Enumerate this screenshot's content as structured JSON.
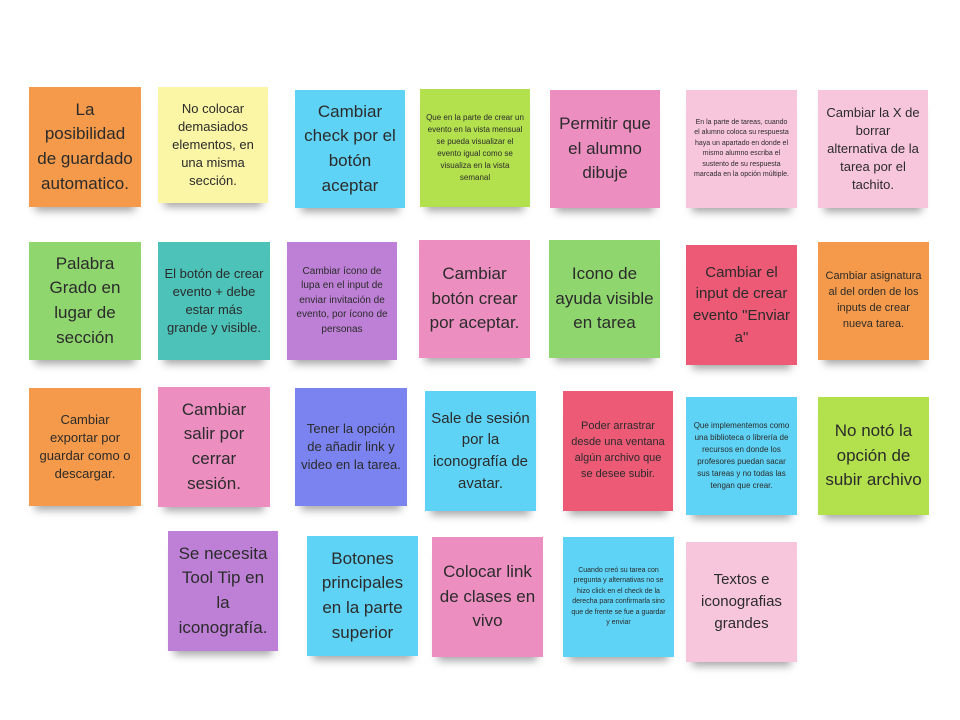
{
  "notes": [
    {
      "text": "La posibilidad de guardado automatico.",
      "color": "#f59a4a"
    },
    {
      "text": "No colocar demasiados elementos, en una misma sección.",
      "color": "#fbf5a6"
    },
    {
      "text": "Cambiar check por el botón aceptar",
      "color": "#5fd3f5"
    },
    {
      "text": "Que en la parte de crear un evento en la vista mensual se pueda visualizar el evento igual como se visualiza en la vista semanal",
      "color": "#b3e04d"
    },
    {
      "text": "Permitir que el alumno dibuje",
      "color": "#ec8fc0"
    },
    {
      "text": "En la parte de tareas, cuando el alumno coloca su respuesta haya un apartado en donde el mismo alumno escriba el sustento de su respuesta marcada en la opción múltiple.",
      "color": "#f8c6dc"
    },
    {
      "text": "Cambiar la X de borrar alternativa de la tarea por el tachito.",
      "color": "#f8c6dc"
    },
    {
      "text": "Palabra Grado en lugar de sección",
      "color": "#8fd66e"
    },
    {
      "text": "El botón de crear evento + debe estar más grande y visible.",
      "color": "#4dc2b9"
    },
    {
      "text": "Cambiar ícono de lupa en el input de enviar invitación de evento, por ícono de personas",
      "color": "#be80d6"
    },
    {
      "text": "Cambiar botón crear por aceptar.",
      "color": "#ec8fc0"
    },
    {
      "text": "Icono de ayuda visible en tarea",
      "color": "#8fd66e"
    },
    {
      "text": "Cambiar el input de crear evento \"Enviar a\"",
      "color": "#ec5a76"
    },
    {
      "text": "Cambiar asignatura al del orden de los inputs de crear nueva tarea.",
      "color": "#f59a4a"
    },
    {
      "text": "Cambiar exportar por guardar como o descargar.",
      "color": "#f59a4a"
    },
    {
      "text": "Cambiar salir por cerrar sesión.",
      "color": "#ec8fc0"
    },
    {
      "text": "Tener la opción de añadir link y video en la tarea.",
      "color": "#7b83f0"
    },
    {
      "text": "Sale de sesión por la iconografía de avatar.",
      "color": "#5fd3f5"
    },
    {
      "text": "Poder arrastrar desde una ventana algún archivo que se desee subir.",
      "color": "#ec5a76"
    },
    {
      "text": "Que implementemos como una biblioteca o librería de recursos en donde los profesores puedan sacar sus tareas y no todas las tengan que crear.",
      "color": "#5fd3f5"
    },
    {
      "text": "No notó la opción de subir archivo",
      "color": "#b3e04d"
    },
    {
      "text": "Se necesita Tool Tip en la iconografía.",
      "color": "#be80d6"
    },
    {
      "text": "Botones principales en la parte superior",
      "color": "#5fd3f5"
    },
    {
      "text": "Colocar link de clases en vivo",
      "color": "#ec8fc0"
    },
    {
      "text": "Cuando creó su tarea con pregunta y alternativas no se hizo click en el check de la derecha para confirmarla sino que de frente se fue a guardar y enviar",
      "color": "#5fd3f5"
    },
    {
      "text": "Textos e iconografias grandes",
      "color": "#f8c6dc"
    }
  ]
}
